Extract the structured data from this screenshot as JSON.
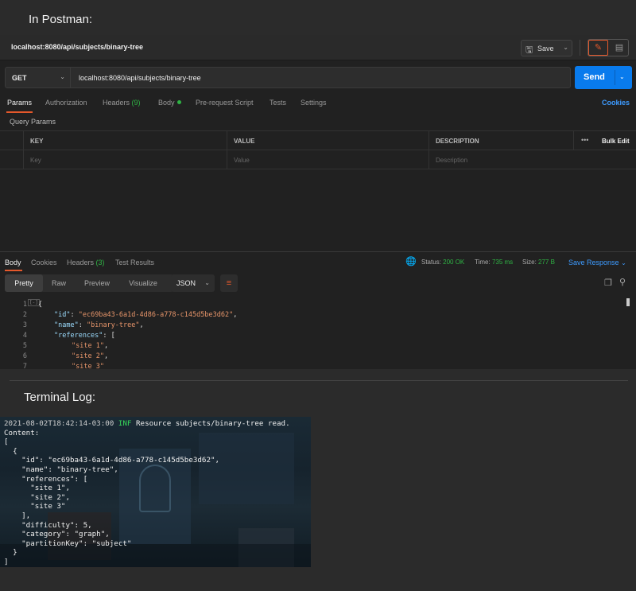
{
  "captions": {
    "postman": "In Postman:",
    "terminal": "Terminal Log:"
  },
  "postman": {
    "request_title": "localhost:8080/api/subjects/binary-tree",
    "save_label": "Save",
    "method": "GET",
    "url": "localhost:8080/api/subjects/binary-tree",
    "send_label": "Send",
    "tabs": [
      {
        "label": "Params"
      },
      {
        "label": "Authorization"
      },
      {
        "label": "Headers",
        "count": "(9)"
      },
      {
        "label": "Body"
      },
      {
        "label": "Pre-request Script"
      },
      {
        "label": "Tests"
      },
      {
        "label": "Settings"
      }
    ],
    "cookies_label": "Cookies",
    "query_params_label": "Query Params",
    "params_table": {
      "headers": [
        "KEY",
        "VALUE",
        "DESCRIPTION"
      ],
      "placeholders": [
        "Key",
        "Value",
        "Description"
      ],
      "more": "•••",
      "bulk_edit": "Bulk Edit"
    },
    "response": {
      "tabs": [
        {
          "label": "Body"
        },
        {
          "label": "Cookies"
        },
        {
          "label": "Headers",
          "count": "(3)"
        },
        {
          "label": "Test Results"
        }
      ],
      "status_label": "Status:",
      "status_value": "200 OK",
      "time_label": "Time:",
      "time_value": "735 ms",
      "size_label": "Size:",
      "size_value": "277 B",
      "save_response": "Save Response",
      "formats": [
        "Pretty",
        "Raw",
        "Preview",
        "Visualize"
      ],
      "format_select": "JSON",
      "code_lines": [
        {
          "n": "1",
          "text": "{"
        },
        {
          "n": "2",
          "key": "\"id\"",
          "val": "\"ec69ba43-6a1d-4d86-a778-c145d5be3d62\"",
          "tail": ","
        },
        {
          "n": "3",
          "key": "\"name\"",
          "val": "\"binary-tree\"",
          "tail": ","
        },
        {
          "n": "4",
          "key": "\"references\"",
          "val": "",
          "tail": "["
        },
        {
          "n": "5",
          "val": "\"site 1\"",
          "tail": ","
        },
        {
          "n": "6",
          "val": "\"site 2\"",
          "tail": ","
        },
        {
          "n": "7",
          "val": "\"site 3\"",
          "tail": ""
        }
      ]
    }
  },
  "terminal": {
    "timestamp": "2021-08-02T18:42:14-03:00",
    "level": "INF",
    "message": "Resource subjects/binary-tree read.",
    "lines": [
      "Content:",
      "[",
      "  {",
      "    \"id\": \"ec69ba43-6a1d-4d86-a778-c145d5be3d62\",",
      "    \"name\": \"binary-tree\",",
      "    \"references\": [",
      "      \"site 1\",",
      "      \"site 2\",",
      "      \"site 3\"",
      "    ],",
      "    \"difficulty\": 5,",
      "    \"category\": \"graph\",",
      "    \"partitionKey\": \"subject\"",
      "  }",
      "]"
    ]
  }
}
